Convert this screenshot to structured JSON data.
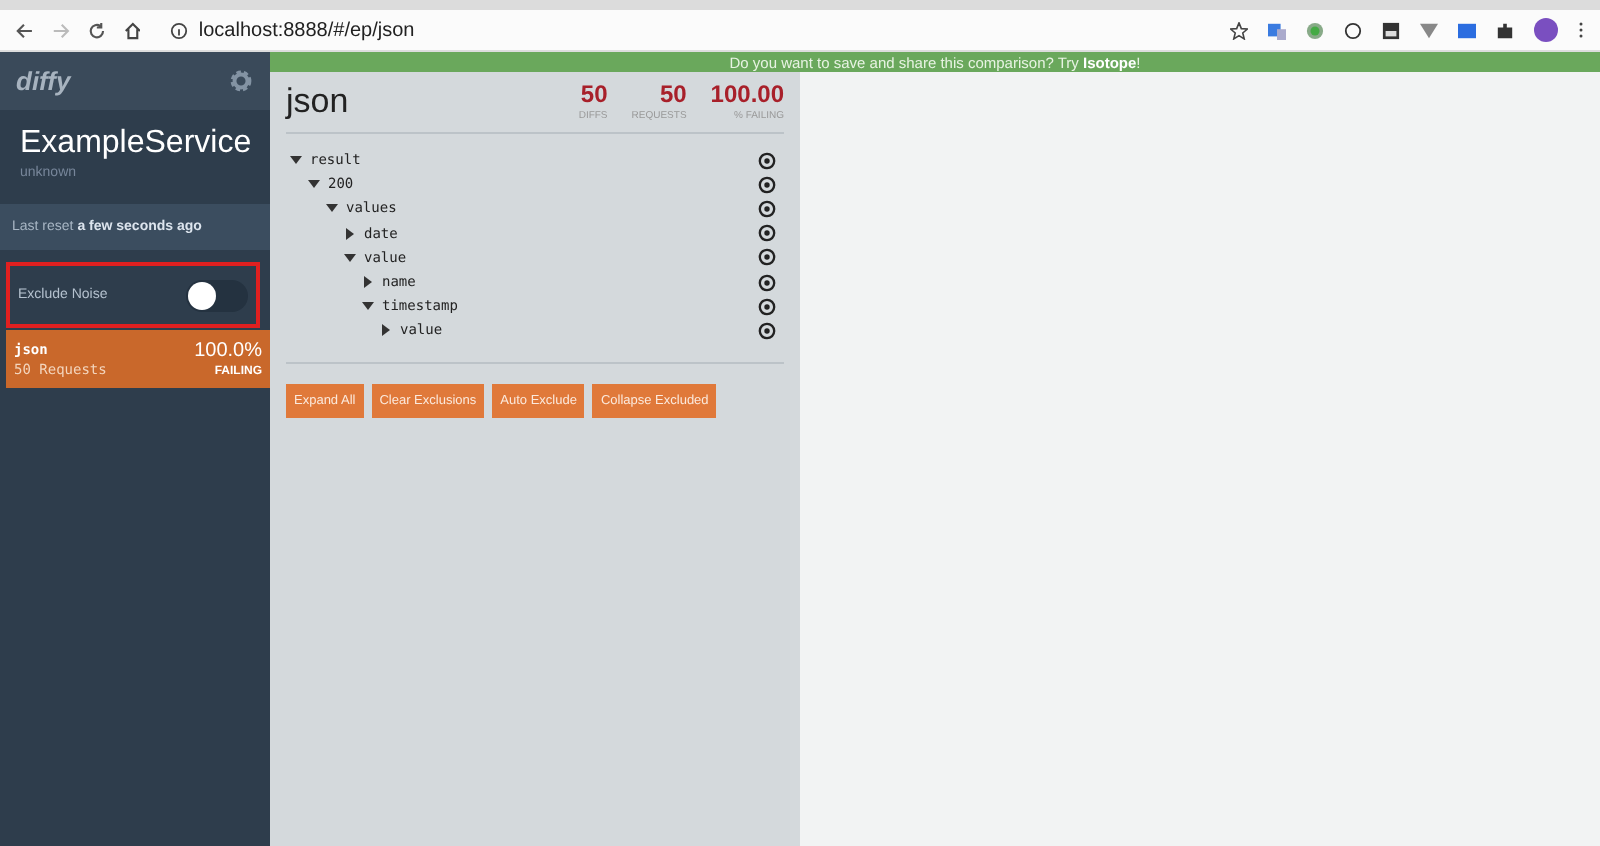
{
  "browser": {
    "url": "localhost:8888/#/ep/json"
  },
  "banner": {
    "text": "Do you want to save and share this comparison? Try **Isotope**!"
  },
  "sidebar": {
    "logo": "diffy",
    "service_name": "ExampleService",
    "service_subtitle": "unknown",
    "last_reset": "Last reset **a few seconds ago**",
    "exclude_noise": {
      "label": "Exclude Noise",
      "on": false
    },
    "endpoints": [
      {
        "name": "json",
        "requests": "50 Requests",
        "percent": "100.0%",
        "status": "FAILING",
        "selected": true
      }
    ]
  },
  "detail": {
    "title": "json",
    "stats": [
      {
        "value": "50",
        "label": "DIFFS"
      },
      {
        "value": "50",
        "label": "REQUESTS"
      },
      {
        "value": "100.00",
        "label": "% FAILING"
      }
    ],
    "tree": [
      {
        "label": "result",
        "expanded": true,
        "children": [
          {
            "label": "200",
            "expanded": true,
            "children": [
              {
                "label": "values",
                "expanded": true,
                "children": [
                  {
                    "label": "date",
                    "expanded": false
                  },
                  {
                    "label": "value",
                    "expanded": true,
                    "children": [
                      {
                        "label": "name",
                        "expanded": false
                      },
                      {
                        "label": "timestamp",
                        "expanded": true,
                        "children": [
                          {
                            "label": "value",
                            "expanded": false
                          }
                        ]
                      }
                    ]
                  }
                ]
              }
            ]
          }
        ]
      }
    ],
    "buttons": [
      "Expand All",
      "Clear Exclusions",
      "Auto Exclude",
      "Collapse Excluded"
    ]
  }
}
